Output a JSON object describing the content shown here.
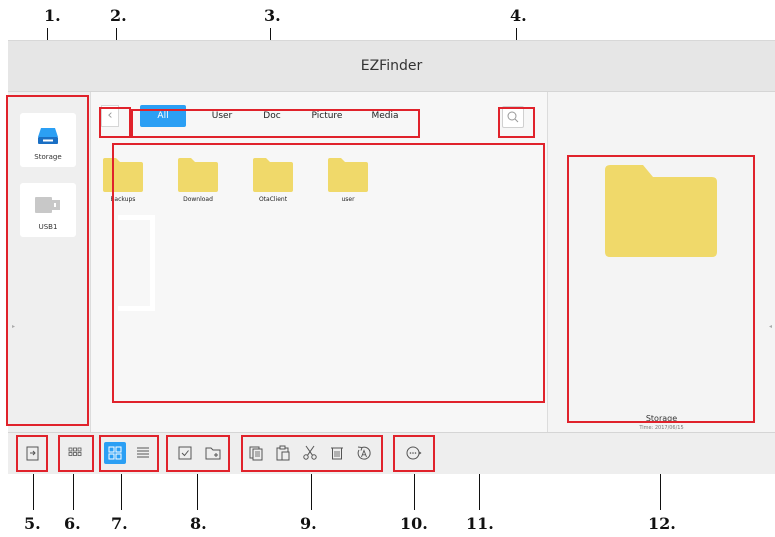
{
  "callouts": [
    "1.",
    "2.",
    "3.",
    "4.",
    "5.",
    "6.",
    "7.",
    "8.",
    "9.",
    "10.",
    "11.",
    "12."
  ],
  "app": {
    "title": "EZFinder"
  },
  "sidebar": {
    "items": [
      {
        "label": "Storage",
        "icon": "storage-drive-icon",
        "selected": true
      },
      {
        "label": "USB1",
        "icon": "usb-drive-icon",
        "selected": false
      }
    ]
  },
  "tabs": [
    {
      "label": "All",
      "active": true
    },
    {
      "label": "User",
      "active": false
    },
    {
      "label": "Doc",
      "active": false
    },
    {
      "label": "Picture",
      "active": false
    },
    {
      "label": "Media",
      "active": false
    }
  ],
  "files": [
    {
      "name": "backups",
      "icon": "folder-icon"
    },
    {
      "name": "Download",
      "icon": "folder-icon"
    },
    {
      "name": "OtaClient",
      "icon": "folder-icon"
    },
    {
      "name": "user",
      "icon": "folder-icon"
    }
  ],
  "preview": {
    "name": "Storage",
    "time": "Time: 2017/06/15",
    "icon": "folder-icon"
  },
  "toolbar": {
    "icons": [
      "exit-icon",
      "apps-icon",
      "grid-view-icon",
      "list-view-icon",
      "select-icon",
      "new-folder-icon",
      "copy-icon",
      "paste-icon",
      "cut-icon",
      "delete-icon",
      "rename-icon",
      "more-icon"
    ],
    "active_view": "grid"
  },
  "colors": {
    "accent": "#2b9ff4",
    "callout_box": "#e0222b",
    "folder": "#f0d96a"
  }
}
